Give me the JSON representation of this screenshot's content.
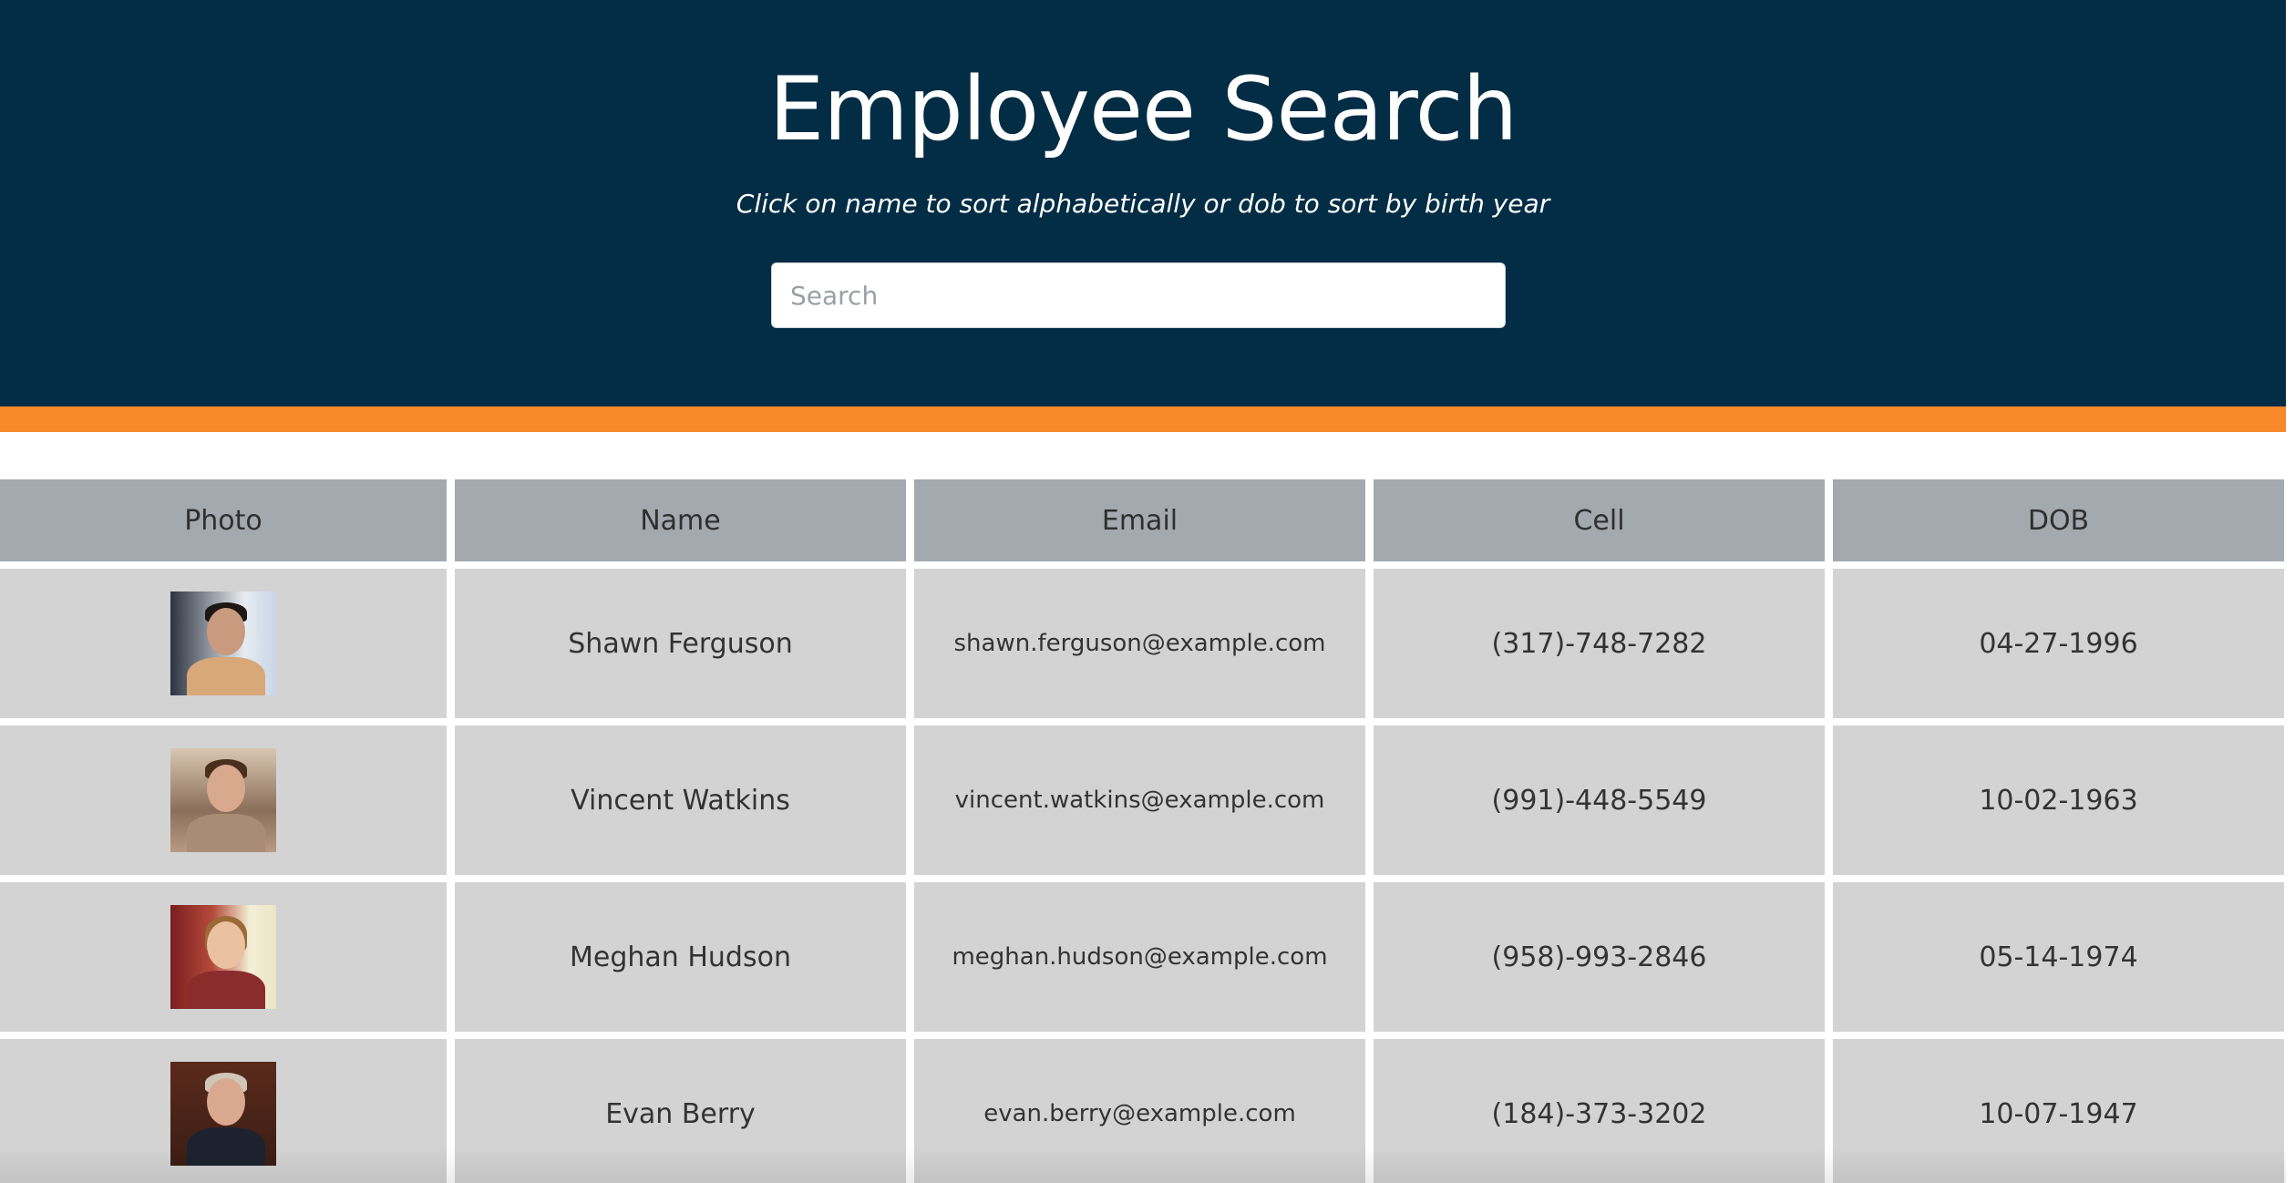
{
  "header": {
    "title": "Employee Search",
    "subtitle": "Click on name to sort alphabetically or dob to sort by birth year"
  },
  "search": {
    "placeholder": "Search",
    "value": ""
  },
  "colors": {
    "header_bg": "#032d45",
    "accent": "#f8882a",
    "table_header_bg": "#a4a9b0",
    "row_bg": "#d3d3d3"
  },
  "table": {
    "columns": [
      "Photo",
      "Name",
      "Email",
      "Cell",
      "DOB"
    ],
    "rows": [
      {
        "name": "Shawn Ferguson",
        "email": "shawn.ferguson@example.com",
        "cell": "(317)-748-7282",
        "dob": "04-27-1996",
        "photo": "employee-photo"
      },
      {
        "name": "Vincent Watkins",
        "email": "vincent.watkins@example.com",
        "cell": "(991)-448-5549",
        "dob": "10-02-1963",
        "photo": "employee-photo"
      },
      {
        "name": "Meghan Hudson",
        "email": "meghan.hudson@example.com",
        "cell": "(958)-993-2846",
        "dob": "05-14-1974",
        "photo": "employee-photo"
      },
      {
        "name": "Evan Berry",
        "email": "evan.berry@example.com",
        "cell": "(184)-373-3202",
        "dob": "10-07-1947",
        "photo": "employee-photo"
      }
    ]
  }
}
